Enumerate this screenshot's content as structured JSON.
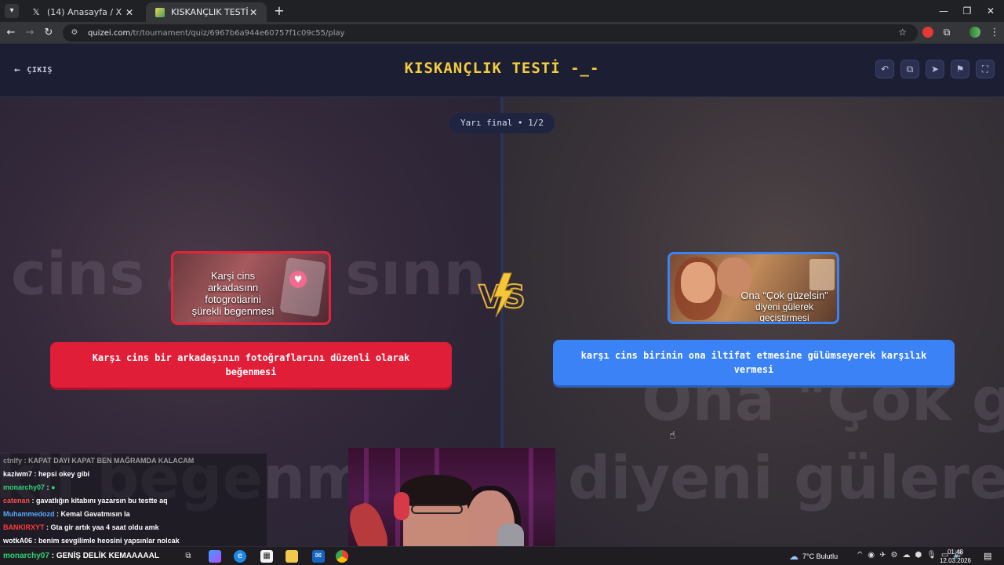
{
  "browser": {
    "tabs": [
      {
        "title": "(14) Anasayfa / X",
        "icon": "x-logo-icon"
      },
      {
        "title": "KISKANÇLIK TESTİ -_- - Tier List",
        "icon": "quizei-favicon-icon"
      }
    ],
    "url_host": "quizei.com",
    "url_path": "/tr/tournament/quiz/6967b6a944e60757f1c09c55/play"
  },
  "header": {
    "exit_label": "ÇIKIŞ",
    "title": "KISKANÇLIK TESTİ -_-"
  },
  "round": {
    "label": "Yarı final • 1/2"
  },
  "choices": {
    "left": {
      "image_caption_line1": "Karşi cins arkadasınn",
      "image_caption_line2": "fotogrotiarini",
      "image_caption_line3": "şürekli begenmesi",
      "label": "Karşı cins bir arkadaşının fotoğraflarını düzenli olarak beğenmesi",
      "accent": "#e01e37"
    },
    "right": {
      "image_caption_line1": "Ona “Çok güzelsin”",
      "image_caption_line2": "diyeni gülerek geçiştirmesi",
      "label": "karşı cins birinin ona iltifat etmesine gülümseyerek karşılık vermesi",
      "accent": "#3b82f6"
    },
    "vs_label": "VS"
  },
  "background_text": {
    "left_line1": "cins a",
    "left_line1b": "sınn",
    "left_line2": "kli begenm",
    "right_line1": "Ona \"Çok gü",
    "right_line2": "diyeni gülerek g"
  },
  "chat": [
    {
      "user": "ctnlfy",
      "text": ": KAPAT DAYI KAPAT BEN MAĞRAMDA KALACAM",
      "color": "#8a8a8a"
    },
    {
      "user": "kaziwm7",
      "text": ": hepsi okey gibi",
      "color": "#ffffff"
    },
    {
      "user": "monarchy07",
      "text": ":",
      "color": "#2ed573"
    },
    {
      "user": "catenan",
      "text": ": gavatlığın kitabını yazarsın bu testte aq",
      "color": "#ff4d4d"
    },
    {
      "user": "Muhammedozd",
      "text": ": Kemal Gavatmısın la",
      "color": "#5aa9ff"
    },
    {
      "user": "BANKIRXYT",
      "text": ": Gta gir artık yaa 4 saat oldu amk",
      "color": "#ff3b3b"
    },
    {
      "user": "wotkA06",
      "text": ": benim sevgilimle heosini yapsınlar nolcak",
      "color": "#ffffff"
    }
  ],
  "taskbar": {
    "ticker_user": "monarchy07",
    "ticker_text": "GENİŞ DELİK KEMAAAAAL",
    "weather": "7°C  Bulutlu",
    "time": "01:48",
    "date": "12.03.2026"
  }
}
